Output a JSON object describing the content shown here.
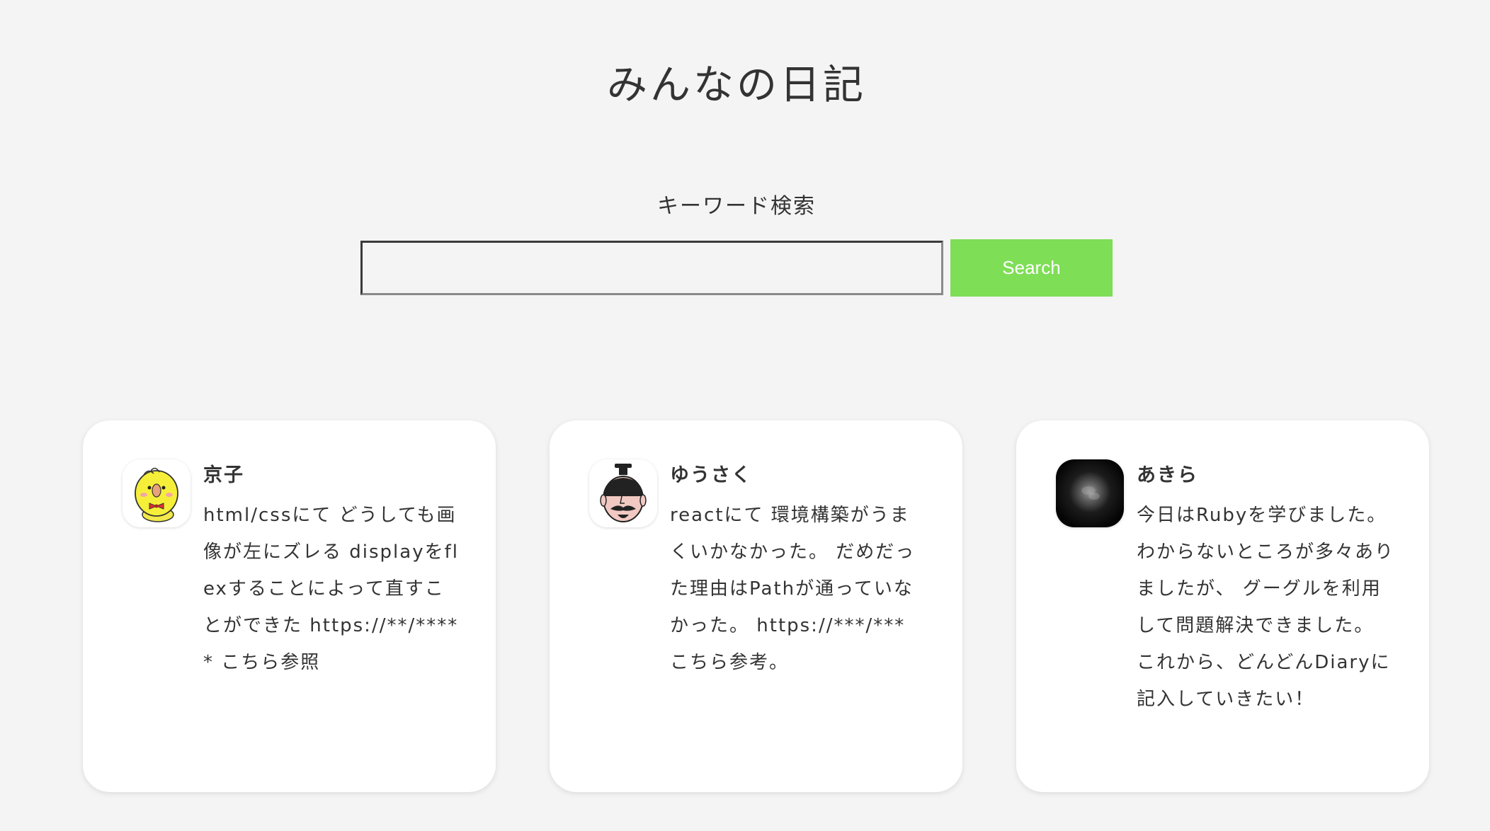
{
  "header": {
    "title": "みんなの日記"
  },
  "search": {
    "label": "キーワード検索",
    "value": "",
    "placeholder": "",
    "button_label": "Search",
    "button_color": "#7ede56"
  },
  "posts": [
    {
      "author": "京子",
      "avatar_icon": "yellow-chick-avatar-icon",
      "body": "html/cssにて どうしても画像が左にズレる displayをflexすることによって直すことができた https://**/***** こちら参照"
    },
    {
      "author": "ゆうさく",
      "avatar_icon": "mustache-man-avatar-icon",
      "body": "reactにて 環境構築がうまくいかなかった。 だめだった理由はPathが通っていなかった。 https://***/*** こちら参考。"
    },
    {
      "author": "あきら",
      "avatar_icon": "dark-orb-avatar-icon",
      "body": "今日はRubyを学びました。 わからないところが多々ありましたが、 グーグルを利用して問題解決できました。 これから、どんどんDiaryに記入していきたい！"
    }
  ]
}
